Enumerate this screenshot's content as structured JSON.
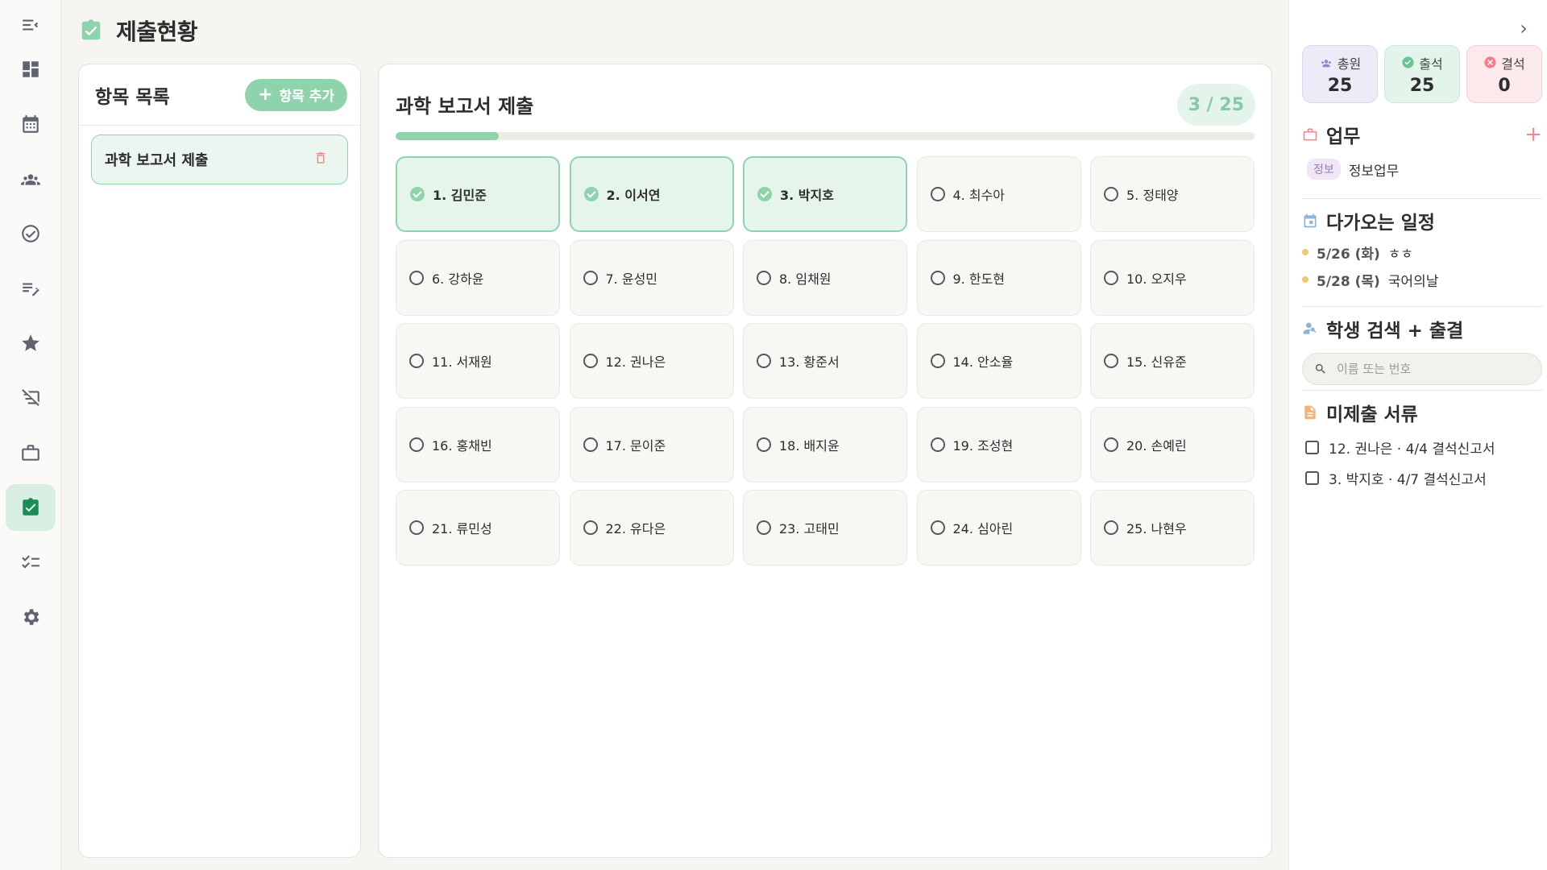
{
  "page": {
    "title": "제출현황"
  },
  "nav": {
    "items": [
      {
        "icon": "collapse-menu-icon"
      },
      {
        "icon": "dashboard-icon"
      },
      {
        "icon": "calendar-icon"
      },
      {
        "icon": "students-icon"
      },
      {
        "icon": "check-circle-icon"
      },
      {
        "icon": "edit-list-icon"
      },
      {
        "icon": "star-icon"
      },
      {
        "icon": "no-signal-icon"
      },
      {
        "icon": "briefcase-icon"
      },
      {
        "icon": "submission-clipboard-icon",
        "active": true
      },
      {
        "icon": "checklist-icon"
      },
      {
        "icon": "settings-icon"
      }
    ]
  },
  "list_panel": {
    "title": "항목 목록",
    "add_button": "항목 추가",
    "items": [
      {
        "label": "과학 보고서 제출"
      }
    ]
  },
  "main": {
    "title": "과학 보고서 제출",
    "count": "3 / 25",
    "progress_fraction": 0.12,
    "students": [
      {
        "label": "1. 김민준",
        "done": true
      },
      {
        "label": "2. 이서연",
        "done": true
      },
      {
        "label": "3. 박지호",
        "done": true
      },
      {
        "label": "4. 최수아",
        "done": false
      },
      {
        "label": "5. 정태양",
        "done": false
      },
      {
        "label": "6. 강하윤",
        "done": false
      },
      {
        "label": "7. 윤성민",
        "done": false
      },
      {
        "label": "8. 임채원",
        "done": false
      },
      {
        "label": "9. 한도현",
        "done": false
      },
      {
        "label": "10. 오지우",
        "done": false
      },
      {
        "label": "11. 서재원",
        "done": false
      },
      {
        "label": "12. 권나은",
        "done": false
      },
      {
        "label": "13. 황준서",
        "done": false
      },
      {
        "label": "14. 안소율",
        "done": false
      },
      {
        "label": "15. 신유준",
        "done": false
      },
      {
        "label": "16. 홍채빈",
        "done": false
      },
      {
        "label": "17. 문이준",
        "done": false
      },
      {
        "label": "18. 배지윤",
        "done": false
      },
      {
        "label": "19. 조성현",
        "done": false
      },
      {
        "label": "20. 손예린",
        "done": false
      },
      {
        "label": "21. 류민성",
        "done": false
      },
      {
        "label": "22. 유다은",
        "done": false
      },
      {
        "label": "23. 고태민",
        "done": false
      },
      {
        "label": "24. 심아린",
        "done": false
      },
      {
        "label": "25. 나현우",
        "done": false
      }
    ]
  },
  "sidebar": {
    "stats": {
      "total": {
        "label": "총원",
        "value": "25"
      },
      "present": {
        "label": "출석",
        "value": "25"
      },
      "absent": {
        "label": "결석",
        "value": "0"
      }
    },
    "duty": {
      "title": "업무",
      "tag": "정보",
      "text": "정보업무"
    },
    "schedule": {
      "title": "다가오는 일정",
      "items": [
        {
          "date": "5/26 (화)",
          "text": "ㅎㅎ"
        },
        {
          "date": "5/28 (목)",
          "text": "국어의날"
        }
      ]
    },
    "search": {
      "title": "학생 검색 + 출결",
      "placeholder": "이름 또는 번호"
    },
    "missing": {
      "title": "미제출 서류",
      "items": [
        {
          "text": "12. 권나은 · 4/4 결석신고서"
        },
        {
          "text": "3. 박지호 · 4/7 결석신고서"
        }
      ]
    }
  },
  "colors": {
    "accent": "#8fd3ad",
    "accent_bg": "#e6f5ec",
    "danger": "#f08a8f"
  }
}
